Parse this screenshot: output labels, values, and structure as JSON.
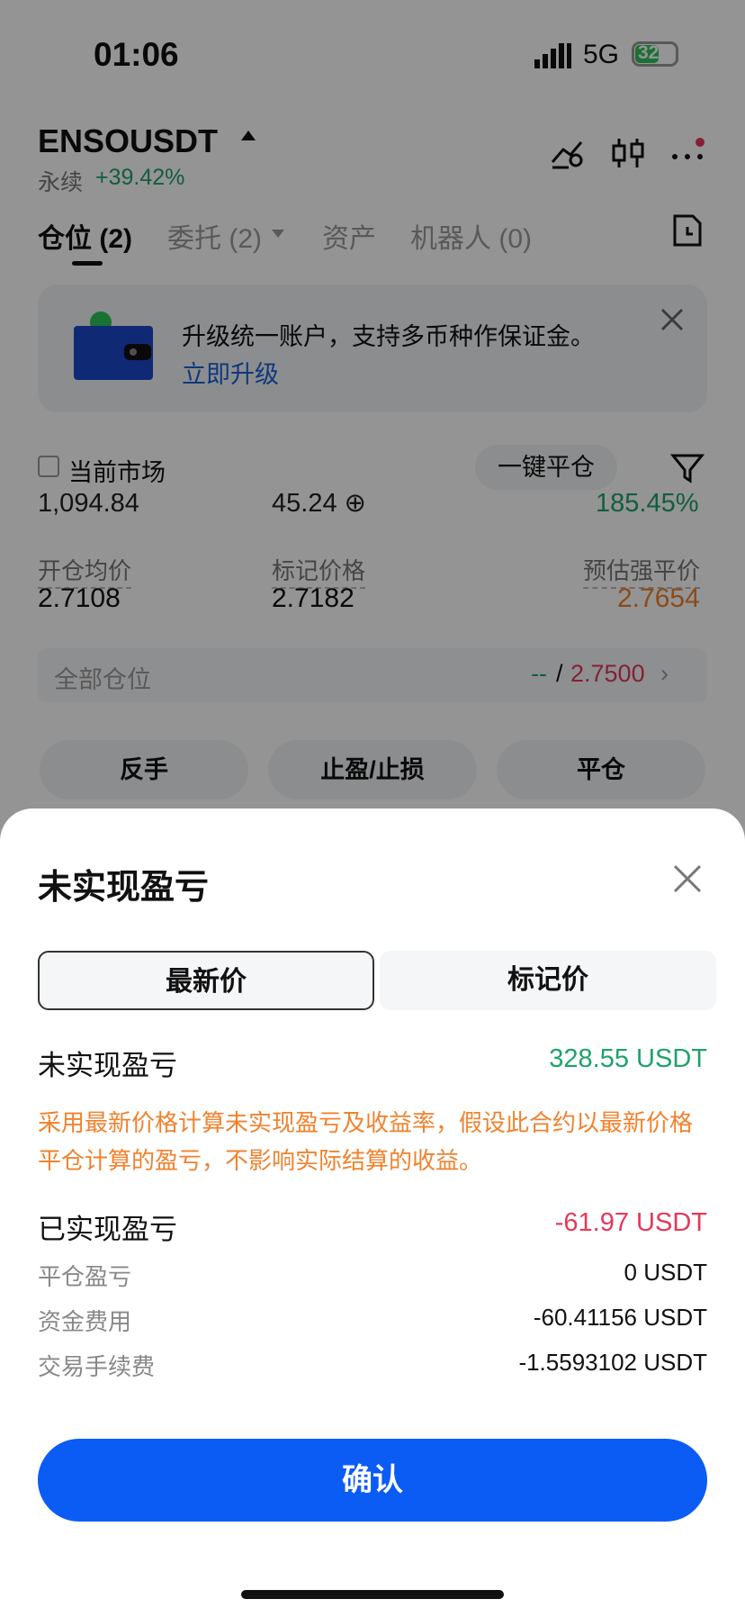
{
  "status": {
    "time": "01:06",
    "network": "5G",
    "battery": "32"
  },
  "header": {
    "pair": "ENSOUSDT",
    "type": "永续",
    "change": "+39.42%"
  },
  "tabs": {
    "positions": "仓位 (2)",
    "orders": "委托 (2)",
    "assets": "资产",
    "bots": "机器人 (0)"
  },
  "banner": {
    "text": "升级统一账户，支持多币种作保证金。",
    "link": "立即升级"
  },
  "filter": {
    "current_market": "当前市场",
    "close_all": "一键平仓"
  },
  "position": {
    "cut_values": [
      "1,094.84",
      "45.24 ⊕",
      "185.45%"
    ],
    "entry_label": "开仓均价",
    "entry_value": "2.7108",
    "mark_label": "标记价格",
    "mark_value": "2.7182",
    "liq_label": "预估强平价",
    "liq_value": "2.7654",
    "all_label": "全部仓位",
    "tp": "--",
    "sl": "2.7500"
  },
  "actions": {
    "reverse": "反手",
    "tpsl": "止盈/止损",
    "close": "平仓"
  },
  "sheet": {
    "title": "未实现盈亏",
    "seg_latest": "最新价",
    "seg_mark": "标记价",
    "unrealized_label": "未实现盈亏",
    "unrealized_value": "328.55 USDT",
    "note": "采用最新价格计算未实现盈亏及收益率，假设此合约以最新价格平仓计算的盈亏，不影响实际结算的收益。",
    "realized_label": "已实现盈亏",
    "realized_value": "-61.97 USDT",
    "close_pnl_label": "平仓盈亏",
    "close_pnl_value": "0 USDT",
    "funding_label": "资金费用",
    "funding_value": "-60.41156 USDT",
    "fee_label": "交易手续费",
    "fee_value": "-1.5593102 USDT",
    "confirm": "确认"
  },
  "colors": {
    "green": "#1fa26b",
    "red": "#e5385b",
    "orange": "#f0822e",
    "blue": "#0a5cf5"
  }
}
